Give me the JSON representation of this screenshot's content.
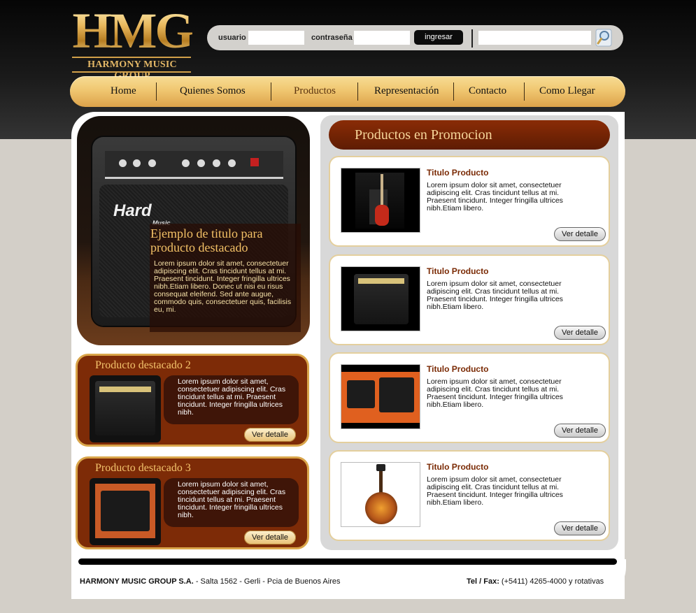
{
  "brand": {
    "logo_letters": "HMG",
    "logo_subtitle": "HARMONY MUSIC GROUP",
    "gold": "#e3b766"
  },
  "login": {
    "user_label": "usuario",
    "user_value": "",
    "password_label": "contraseña",
    "password_value": "",
    "submit_label": "ingresar",
    "search_value": "",
    "search_icon": "magnifier-icon"
  },
  "nav": {
    "items": [
      {
        "label": "Home"
      },
      {
        "label": "Quienes Somos"
      },
      {
        "label": "Productos"
      },
      {
        "label": "Representación"
      },
      {
        "label": "Contacto"
      },
      {
        "label": "Como Llegar"
      }
    ],
    "active": "Productos"
  },
  "hero": {
    "amp_brand": "Hard",
    "amp_brand_sub": "Music",
    "title": "Ejemplo de titulo para producto destacado",
    "text": "Lorem ipsum dolor sit amet, consectetuer adipiscing elit. Cras tincidunt tellus at mi. Praesent tincidunt. Integer fringilla ultrices nibh.Etiam libero. Donec ut nisi eu risus consequat eleifend. Sed ante augue, commodo quis, consectetuer quis, facilisis eu, mi."
  },
  "featured": [
    {
      "title": "Producto destacado 2",
      "text": "Lorem ipsum dolor sit amet, consectetuer adipiscing elit. Cras tincidunt tellus at mi. Praesent tincidunt. Integer fringilla ultrices nibh.",
      "button": "Ver detalle"
    },
    {
      "title": "Producto destacado 3",
      "text": "Lorem ipsum dolor sit amet, consectetuer adipiscing elit. Cras tincidunt tellus at mi. Praesent tincidunt. Integer fringilla ultrices nibh.",
      "button": "Ver detalle"
    }
  ],
  "promo": {
    "header": "Productos en Promocion",
    "products": [
      {
        "title": "Titulo Producto",
        "desc": "Lorem ipsum dolor sit amet, consectetuer adipiscing elit. Cras tincidunt tellus at mi. Praesent tincidunt. Integer fringilla ultrices nibh.Etiam libero.",
        "button": "Ver detalle",
        "image": "red-guitar-photo"
      },
      {
        "title": "Titulo Producto",
        "desc": "Lorem ipsum dolor sit amet, consectetuer adipiscing elit. Cras tincidunt tellus at mi. Praesent tincidunt. Integer fringilla ultrices nibh.Etiam libero.",
        "button": "Ver detalle",
        "image": "amplifier-photo"
      },
      {
        "title": "Titulo Producto",
        "desc": "Lorem ipsum dolor sit amet, consectetuer adipiscing elit. Cras tincidunt tellus at mi. Praesent tincidunt. Integer fringilla ultrices nibh.Etiam libero.",
        "button": "Ver detalle",
        "image": "two-amplifiers-photo"
      },
      {
        "title": "Titulo Producto",
        "desc": "Lorem ipsum dolor sit amet, consectetuer adipiscing elit. Cras tincidunt tellus at mi. Praesent tincidunt. Integer fringilla ultrices nibh.Etiam libero.",
        "button": "Ver detalle",
        "image": "sunburst-guitar-photo"
      }
    ]
  },
  "footer": {
    "company": "HARMONY MUSIC GROUP S.A.",
    "address": " - Salta 1562 - Gerli - Pcia de Buenos Aires",
    "tel_label": "Tel / Fax:",
    "tel_value": " (+5411) 4265-4000 y rotativas"
  }
}
